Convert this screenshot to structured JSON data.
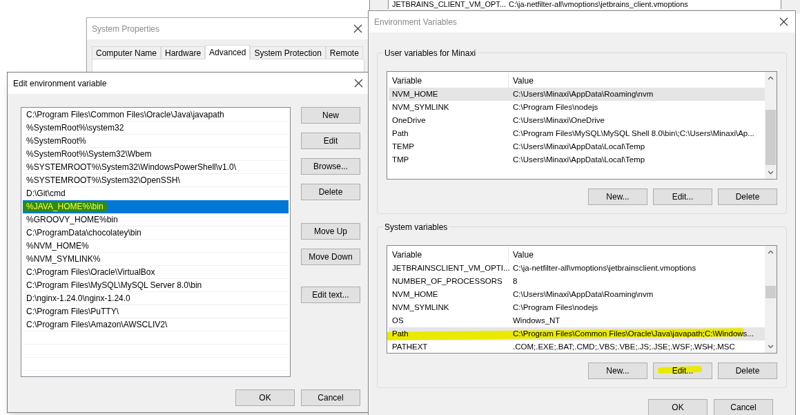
{
  "background_window": {
    "row": {
      "variable": "JETBRAINS_CLIENT_VM_OPT...",
      "value": "C:\\ja-netfilter-all\\vmoptions\\jetbrains_client.vmoptions"
    }
  },
  "system_properties": {
    "title": "System Properties",
    "tabs": [
      {
        "label": "Computer Name",
        "selected": false
      },
      {
        "label": "Hardware",
        "selected": false
      },
      {
        "label": "Advanced",
        "selected": true
      },
      {
        "label": "System Protection",
        "selected": false
      },
      {
        "label": "Remote",
        "selected": false
      }
    ]
  },
  "edit_dialog": {
    "title": "Edit environment variable",
    "entries": [
      {
        "text": "C:\\Program Files\\Common Files\\Oracle\\Java\\javapath",
        "selected": false,
        "marked": false
      },
      {
        "text": "%SystemRoot%\\system32",
        "selected": false,
        "marked": false
      },
      {
        "text": "%SystemRoot%",
        "selected": false,
        "marked": false
      },
      {
        "text": "%SystemRoot%\\System32\\Wbem",
        "selected": false,
        "marked": false
      },
      {
        "text": "%SYSTEMROOT%\\System32\\WindowsPowerShell\\v1.0\\",
        "selected": false,
        "marked": false
      },
      {
        "text": "%SYSTEMROOT%\\System32\\OpenSSH\\",
        "selected": false,
        "marked": false
      },
      {
        "text": "D:\\Git\\cmd",
        "selected": false,
        "marked": false
      },
      {
        "text": "%JAVA_HOME%\\bin",
        "selected": true,
        "marked": true
      },
      {
        "text": "%GROOVY_HOME%bin",
        "selected": false,
        "marked": false
      },
      {
        "text": "C:\\ProgramData\\chocolatey\\bin",
        "selected": false,
        "marked": false
      },
      {
        "text": "%NVM_HOME%",
        "selected": false,
        "marked": false
      },
      {
        "text": "%NVM_SYMLINK%",
        "selected": false,
        "marked": false
      },
      {
        "text": "C:\\Program Files\\Oracle\\VirtualBox",
        "selected": false,
        "marked": false
      },
      {
        "text": "C:\\Program Files\\MySQL\\MySQL Server 8.0\\bin",
        "selected": false,
        "marked": false
      },
      {
        "text": "D:\\nginx-1.24.0\\nginx-1.24.0",
        "selected": false,
        "marked": false
      },
      {
        "text": "C:\\Program Files\\PuTTY\\",
        "selected": false,
        "marked": false
      },
      {
        "text": "C:\\Program Files\\Amazon\\AWSCLIV2\\",
        "selected": false,
        "marked": false
      }
    ],
    "side_buttons": [
      "New",
      "Edit",
      "Browse...",
      "Delete",
      "Move Up",
      "Move Down",
      "Edit text..."
    ],
    "buttons": [
      "OK",
      "Cancel"
    ]
  },
  "environment_variables": {
    "title": "Environment Variables",
    "groups": [
      {
        "label": "User variables for Minaxi",
        "columns": [
          "Variable",
          "Value"
        ],
        "rows": [
          {
            "variable": "NVM_HOME",
            "value": "C:\\Users\\Minaxi\\AppData\\Roaming\\nvm",
            "selected": true,
            "marked": false
          },
          {
            "variable": "NVM_SYMLINK",
            "value": "C:\\Program Files\\nodejs",
            "selected": false,
            "marked": false
          },
          {
            "variable": "OneDrive",
            "value": "C:\\Users\\Minaxi\\OneDrive",
            "selected": false,
            "marked": false
          },
          {
            "variable": "Path",
            "value": "C:\\Program Files\\MySQL\\MySQL Shell 8.0\\bin\\;C:\\Users\\Minaxi\\Ap...",
            "selected": false,
            "marked": false
          },
          {
            "variable": "TEMP",
            "value": "C:\\Users\\Minaxi\\AppData\\Local\\Temp",
            "selected": false,
            "marked": false
          },
          {
            "variable": "TMP",
            "value": "C:\\Users\\Minaxi\\AppData\\Local\\Temp",
            "selected": false,
            "marked": false
          }
        ],
        "buttons": [
          {
            "label": "New...",
            "marked": false
          },
          {
            "label": "Edit...",
            "marked": false
          },
          {
            "label": "Delete",
            "marked": false
          }
        ]
      },
      {
        "label": "System variables",
        "columns": [
          "Variable",
          "Value"
        ],
        "rows": [
          {
            "variable": "JETBRAINSCLIENT_VM_OPTI...",
            "value": "C:\\ja-netfilter-all\\vmoptions\\jetbrainsclient.vmoptions",
            "selected": false,
            "marked": false
          },
          {
            "variable": "NUMBER_OF_PROCESSORS",
            "value": "8",
            "selected": false,
            "marked": false
          },
          {
            "variable": "NVM_HOME",
            "value": "C:\\Users\\Minaxi\\AppData\\Roaming\\nvm",
            "selected": false,
            "marked": false
          },
          {
            "variable": "NVM_SYMLINK",
            "value": "C:\\Program Files\\nodejs",
            "selected": false,
            "marked": false
          },
          {
            "variable": "OS",
            "value": "Windows_NT",
            "selected": false,
            "marked": false
          },
          {
            "variable": "Path",
            "value": "C:\\Program Files\\Common Files\\Oracle\\Java\\javapath;C:\\Windows...",
            "selected": true,
            "marked": true
          },
          {
            "variable": "PATHEXT",
            "value": ".COM;.EXE;.BAT;.CMD;.VBS;.VBE;.JS;.JSE;.WSF;.WSH;.MSC",
            "selected": false,
            "marked": false
          }
        ],
        "buttons": [
          {
            "label": "New...",
            "marked": false
          },
          {
            "label": "Edit...",
            "marked": true
          },
          {
            "label": "Delete",
            "marked": false
          }
        ]
      }
    ],
    "buttons": [
      "OK",
      "Cancel"
    ]
  }
}
